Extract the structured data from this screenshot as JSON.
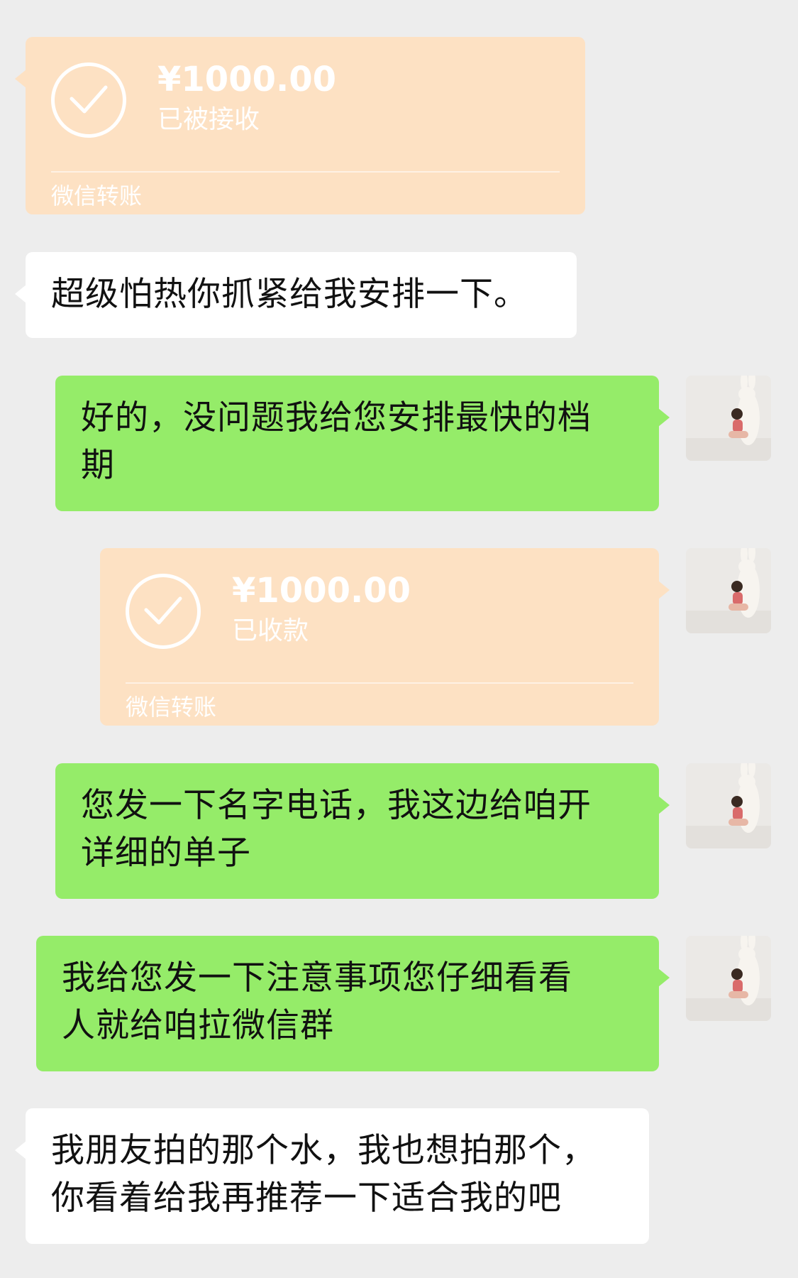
{
  "messages": [
    {
      "type": "transfer",
      "side": "left",
      "amount": "¥1000.00",
      "status": "已被接收",
      "footer": "微信转账"
    },
    {
      "type": "text",
      "side": "left",
      "text": "超级怕热你抓紧给我安排一下。"
    },
    {
      "type": "text",
      "side": "right",
      "line1": "好的，没问题我给您安排最快的档",
      "line2": "期"
    },
    {
      "type": "transfer",
      "side": "right",
      "amount": "¥1000.00",
      "status": "已收款",
      "footer": "微信转账"
    },
    {
      "type": "text",
      "side": "right",
      "line1": "您发一下名字电话，我这边给咱开",
      "line2": "详细的单子"
    },
    {
      "type": "text",
      "side": "right",
      "line1": "我给您发一下注意事项您仔细看看",
      "line2": "人就给咱拉微信群"
    },
    {
      "type": "text",
      "side": "left",
      "line1": "我朋友拍的那个水，我也想拍那个，",
      "line2": "你看着给我再推荐一下适合我的吧"
    }
  ],
  "colors": {
    "background": "#ededed",
    "outgoing_bubble": "#95ec69",
    "incoming_bubble": "#ffffff",
    "transfer_card": "#fde1c3"
  },
  "icons": {
    "transfer_status": "check-circle-icon",
    "avatar": "user-avatar-photo"
  }
}
